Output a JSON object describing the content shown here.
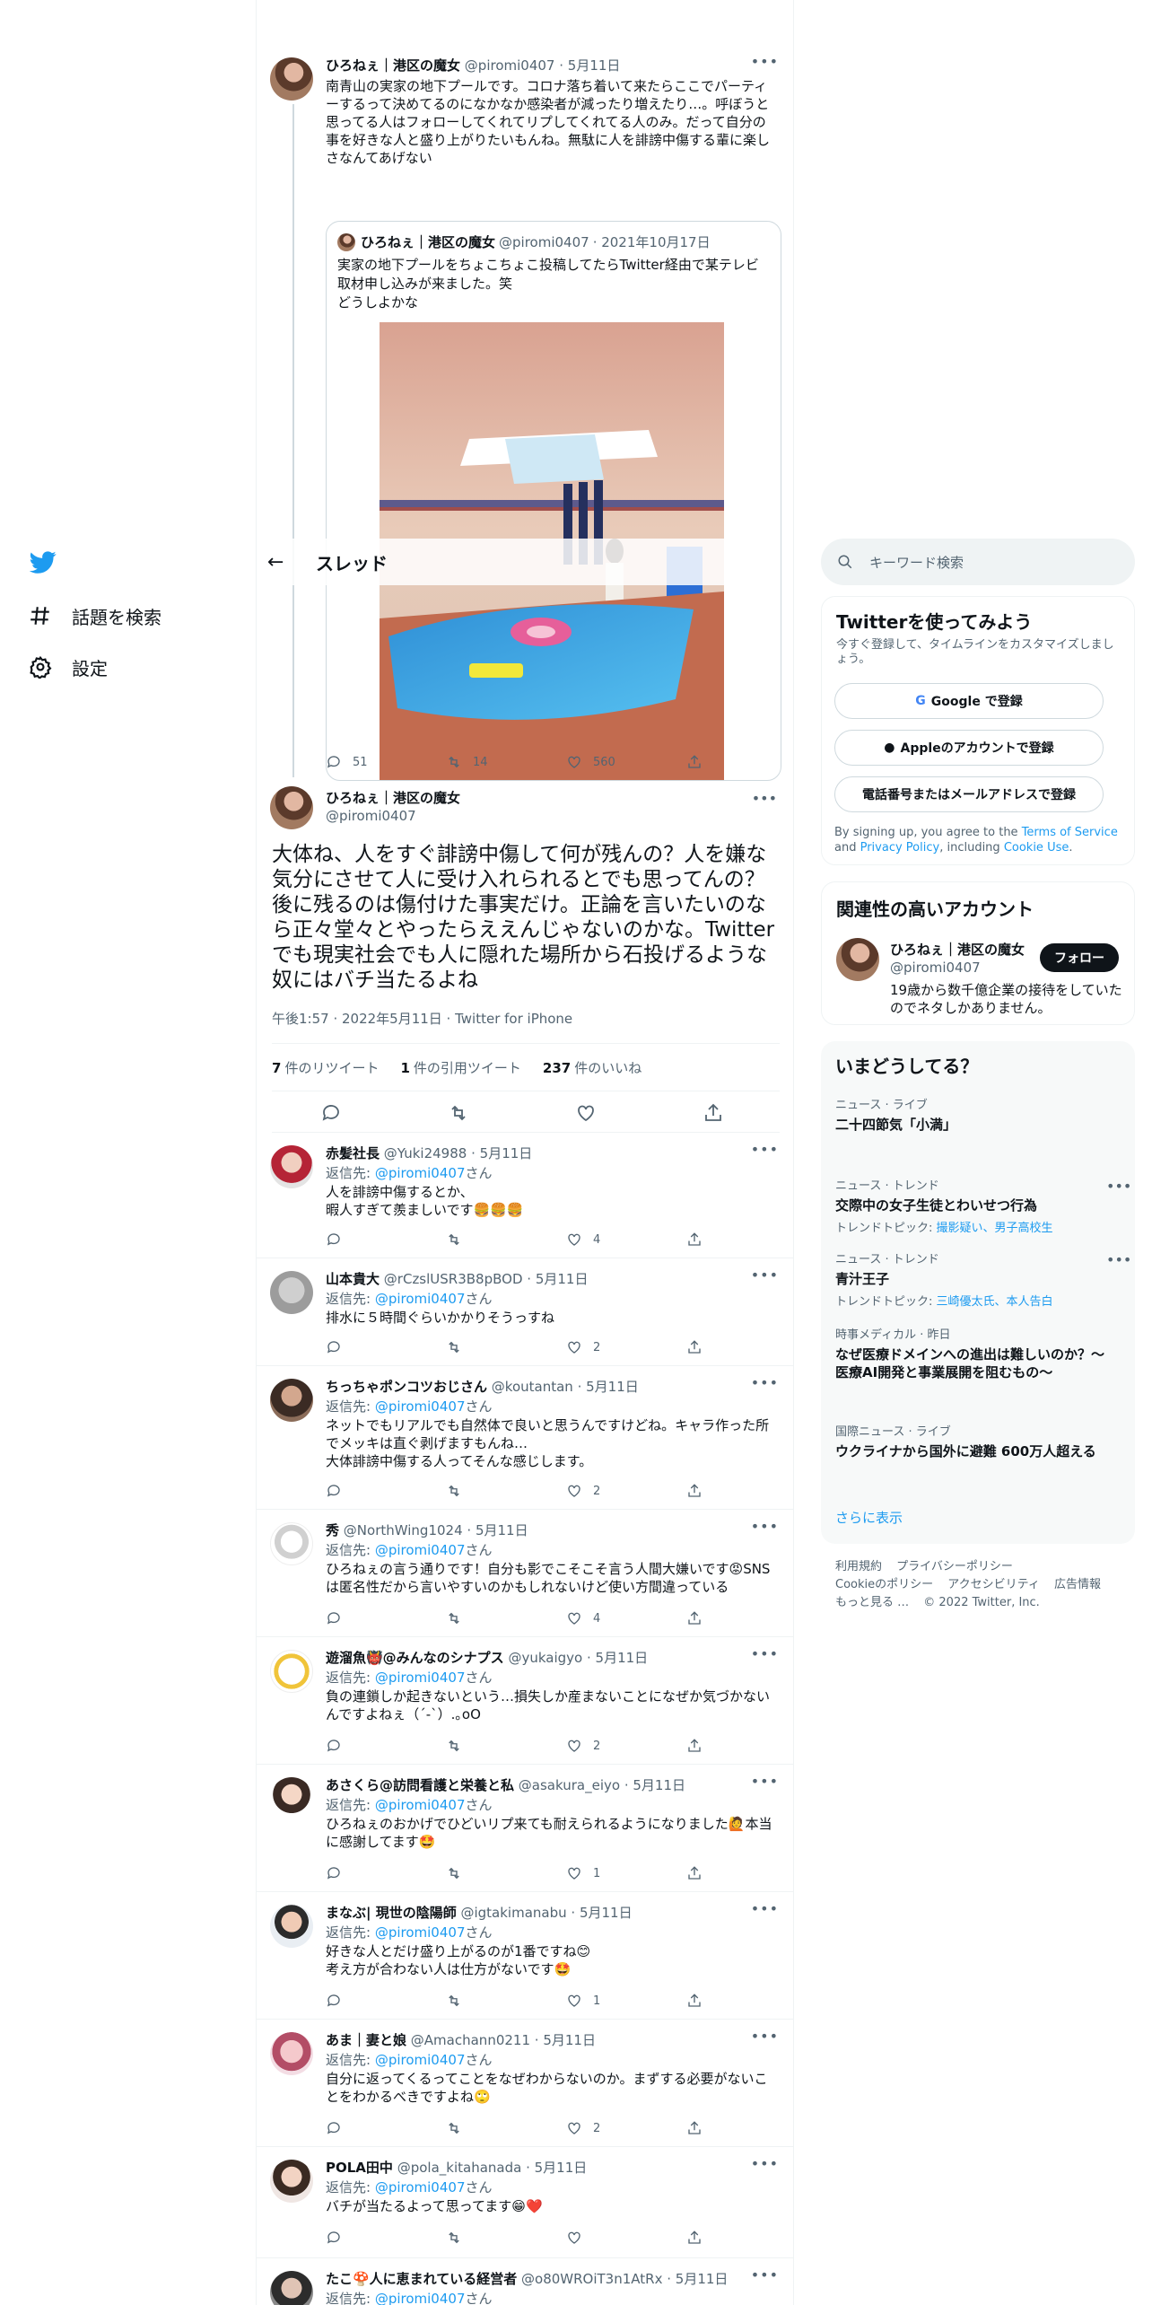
{
  "nav": {
    "explore_label": "話題を検索",
    "settings_label": "設定"
  },
  "topbar": {
    "title": "スレッド"
  },
  "parent_tweet": {
    "name": "ひろねぇ｜港区の魔女",
    "handle": "@piromi0407",
    "date": "· 5月11日",
    "text": "南青山の実家の地下プールです。コロナ落ち着いて来たらここでパーティーするって決めてるのになかなか感染者が減ったり増えたり…。呼ぼうと思ってる人はフォローしてくれてリプしてくれてる人のみ。だって自分の事を好きな人と盛り上がりたいもんね。無駄に人を誹謗中傷する輩に楽しさなんてあげない",
    "quote": {
      "name": "ひろねぇ｜港区の魔女",
      "handle": "@piromi0407",
      "date": "· 2021年10月17日",
      "text_line1": "実家の地下プールをちょこちょこ投稿してたらTwitter経由で某テレビ取材申し込みが来ました。笑",
      "text_line2": "どうしよかな"
    },
    "replies": "51",
    "retweets": "14",
    "likes": "560"
  },
  "main_tweet": {
    "name": "ひろねぇ｜港区の魔女",
    "handle": "@piromi0407",
    "text": "大体ね、人をすぐ誹謗中傷して何が残んの？人を嫌な気分にさせて人に受け入れられるとでも思ってんの？後に残るのは傷付けた事実だけ。正論を言いたいのなら正々堂々とやったらええんじゃないのかな。Twitterでも現実社会でも人に隠れた場所から石投げるような奴にはバチ当たるよね",
    "meta": "午後1:57 · 2022年5月11日 · Twitter for iPhone",
    "retweet_count": "7",
    "retweet_label": "件のリツイート",
    "quote_count": "1",
    "quote_label": "件の引用ツイート",
    "like_count": "237",
    "like_label": "件のいいね"
  },
  "reply_prefix": "返信先: ",
  "reply_suffix": "さん",
  "reply_mention": "@piromi0407",
  "replies": [
    {
      "name": "赤髪社長",
      "handle": "@Yuki24988",
      "date": "· 5月11日",
      "text": "人を誹謗中傷するとか、\n暇人すぎて羨ましいです🍔🍔🍔",
      "likes": "4"
    },
    {
      "name": "山本貴大",
      "handle": "@rCzslUSR3B8pBOD",
      "date": "· 5月11日",
      "text": "排水に５時間ぐらいかかりそうっすね",
      "likes": "2"
    },
    {
      "name": "ちっちゃポンコツおじさん",
      "handle": "@koutantan",
      "date": "· 5月11日",
      "text": "ネットでもリアルでも自然体で良いと思うんですけどね。キャラ作った所でメッキは直ぐ剥げますもんね…\n大体誹謗中傷する人ってそんな感じします。",
      "likes": "2"
    },
    {
      "name": "秀",
      "handle": "@NorthWing1024",
      "date": "· 5月11日",
      "text": "ひろねぇの言う通りです！自分も影でこそこそ言う人間大嫌いです😡SNSは匿名性だから言いやすいのかもしれないけど使い方間違っている",
      "likes": "4"
    },
    {
      "name": "遊溜魚👹@みんなのシナプス",
      "handle": "@yukaigyo",
      "date": "· 5月11日",
      "text": "負の連鎖しか起きないという…損失しか産まないことになぜか気づかないんですよねぇ（´-`）.｡oO",
      "likes": "2"
    },
    {
      "name": "あさくら@訪問看護と栄養と私",
      "handle": "@asakura_eiyo",
      "date": "· 5月11日",
      "text": "ひろねぇのおかげでひどいリプ来ても耐えられるようになりました🙋本当に感謝してます🤩",
      "likes": "1"
    },
    {
      "name": "まなぶ| 現世の陰陽師",
      "handle": "@igtakimanabu",
      "date": "· 5月11日",
      "text": "好きな人とだけ盛り上がるのが1番ですね😊\n考え方が合わない人は仕方がないです🤩",
      "likes": "1"
    },
    {
      "name": "あま｜妻と娘",
      "handle": "@Amachann0211",
      "date": "· 5月11日",
      "text": "自分に返ってくるってことをなぜわからないのか。まずする必要がないことをわかるべきですよね🙄",
      "likes": "2"
    },
    {
      "name": "POLA田中",
      "handle": "@pola_kitahanada",
      "date": "· 5月11日",
      "text": "バチが当たるよって思ってます😁❤️",
      "likes": ""
    },
    {
      "name": "たこ🍄人に恵まれている経営者",
      "handle": "@o80WROiT3n1AtRx",
      "date": "· 5月11日",
      "text": "",
      "likes": ""
    }
  ],
  "right": {
    "search_placeholder": "キーワード検索",
    "signup": {
      "title": "Twitterを使ってみよう",
      "subtitle": "今すぐ登録して、タイムラインをカスタマイズしましょう。",
      "google": "Google で登録",
      "apple": "Appleのアカウントで登録",
      "phone": "電話番号またはメールアドレスで登録",
      "legal_1": "By signing up, you agree to the ",
      "tos": "Terms of Service",
      "legal_2": " and ",
      "privacy": "Privacy Policy",
      "legal_3": ", including ",
      "cookie": "Cookie Use",
      "legal_4": "."
    },
    "related": {
      "title": "関連性の高いアカウント",
      "name": "ひろねぇ｜港区の魔女",
      "handle": "@piromi0407",
      "bio": "19歳から数千億企業の接待をしていたのでネタしかありません。",
      "follow": "フォロー"
    },
    "trends": {
      "title": "いまどうしてる？",
      "items": [
        {
          "cat": "ニュース · ライブ",
          "title": "二十四節気「小満」",
          "sub_prefix": "",
          "sub_links": ""
        },
        {
          "cat": "ニュース · トレンド",
          "title": "交際中の女子生徒とわいせつ行為",
          "sub_prefix": "トレンドトピック: ",
          "sub_links": "撮影疑い、男子高校生"
        },
        {
          "cat": "ニュース · トレンド",
          "title": "青汁王子",
          "sub_prefix": "トレンドトピック: ",
          "sub_links": "三崎優太氏、本人告白"
        },
        {
          "cat": "時事メディカル · 昨日",
          "title": "なぜ医療ドメインへの進出は難しいのか？～医療AI開発と事業展開を阻むもの～",
          "sub_prefix": "",
          "sub_links": ""
        },
        {
          "cat": "国際ニュース · ライブ",
          "title": "ウクライナから国外に避難 600万人超える",
          "sub_prefix": "",
          "sub_links": ""
        }
      ],
      "show_more": "さらに表示"
    },
    "footer": {
      "links": [
        "利用規約",
        "プライバシーポリシー",
        "Cookieのポリシー",
        "アクセシビリティ",
        "広告情報",
        "もっと見る …",
        "© 2022 Twitter, Inc."
      ]
    }
  },
  "colors": {
    "accent": "#1d9bf0",
    "text": "#0f1419",
    "muted": "#536471",
    "border": "#eff3f4"
  }
}
